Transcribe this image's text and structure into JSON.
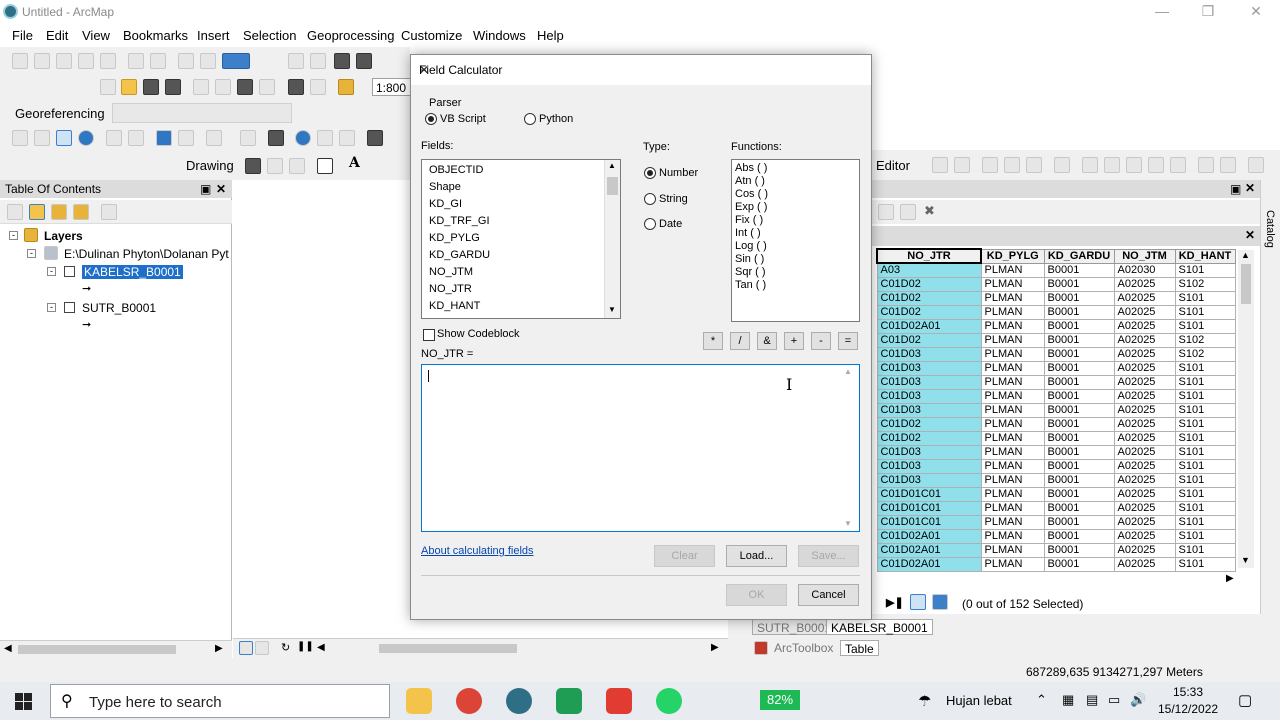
{
  "window": {
    "title": "Untitled - ArcMap"
  },
  "menu": [
    "File",
    "Edit",
    "View",
    "Bookmarks",
    "Insert",
    "Selection",
    "Geoprocessing",
    "Customize",
    "Windows",
    "Help"
  ],
  "toolbar": {
    "scale": "1:800",
    "georeferencing": "Georeferencing",
    "drawing": "Drawing",
    "editor": "Editor"
  },
  "toc": {
    "title": "Table Of Contents",
    "root": "Layers",
    "path": "E:\\Dulinan Phyton\\Dolanan Pyt",
    "layers": [
      "KABELSR_B0001",
      "SUTR_B0001"
    ]
  },
  "table": {
    "headers": [
      "NO_JTR",
      "KD_PYLG",
      "KD_GARDU",
      "NO_JTM",
      "KD_HANT"
    ],
    "rows": [
      [
        "A03",
        "PLMAN",
        "B0001",
        "A02030",
        "S101"
      ],
      [
        "C01D02",
        "PLMAN",
        "B0001",
        "A02025",
        "S102"
      ],
      [
        "C01D02",
        "PLMAN",
        "B0001",
        "A02025",
        "S101"
      ],
      [
        "C01D02",
        "PLMAN",
        "B0001",
        "A02025",
        "S101"
      ],
      [
        "C01D02A01",
        "PLMAN",
        "B0001",
        "A02025",
        "S101"
      ],
      [
        "C01D02",
        "PLMAN",
        "B0001",
        "A02025",
        "S102"
      ],
      [
        "C01D03",
        "PLMAN",
        "B0001",
        "A02025",
        "S102"
      ],
      [
        "C01D03",
        "PLMAN",
        "B0001",
        "A02025",
        "S101"
      ],
      [
        "C01D03",
        "PLMAN",
        "B0001",
        "A02025",
        "S101"
      ],
      [
        "C01D03",
        "PLMAN",
        "B0001",
        "A02025",
        "S101"
      ],
      [
        "C01D03",
        "PLMAN",
        "B0001",
        "A02025",
        "S101"
      ],
      [
        "C01D02",
        "PLMAN",
        "B0001",
        "A02025",
        "S101"
      ],
      [
        "C01D02",
        "PLMAN",
        "B0001",
        "A02025",
        "S101"
      ],
      [
        "C01D03",
        "PLMAN",
        "B0001",
        "A02025",
        "S101"
      ],
      [
        "C01D03",
        "PLMAN",
        "B0001",
        "A02025",
        "S101"
      ],
      [
        "C01D03",
        "PLMAN",
        "B0001",
        "A02025",
        "S101"
      ],
      [
        "C01D01C01",
        "PLMAN",
        "B0001",
        "A02025",
        "S101"
      ],
      [
        "C01D01C01",
        "PLMAN",
        "B0001",
        "A02025",
        "S101"
      ],
      [
        "C01D01C01",
        "PLMAN",
        "B0001",
        "A02025",
        "S101"
      ],
      [
        "C01D02A01",
        "PLMAN",
        "B0001",
        "A02025",
        "S101"
      ],
      [
        "C01D02A01",
        "PLMAN",
        "B0001",
        "A02025",
        "S101"
      ],
      [
        "C01D02A01",
        "PLMAN",
        "B0001",
        "A02025",
        "S101"
      ]
    ],
    "selection": "(0 out of 152 Selected)",
    "tabs": [
      "SUTR_B0001",
      "KABELSR_B0001"
    ],
    "bottom_tabs": [
      "ArcToolbox",
      "Table"
    ]
  },
  "catalog": "Catalog",
  "status": {
    "coords": "687289,635  9134271,297 Meters"
  },
  "dialog": {
    "title": "Field Calculator",
    "parser_label": "Parser",
    "parser_options": [
      "VB Script",
      "Python"
    ],
    "fields_label": "Fields:",
    "fields": [
      "OBJECTID",
      "Shape",
      "KD_GI",
      "KD_TRF_GI",
      "KD_PYLG",
      "KD_GARDU",
      "NO_JTM",
      "NO_JTR",
      "KD_HANT"
    ],
    "type_label": "Type:",
    "types": [
      "Number",
      "String",
      "Date"
    ],
    "functions_label": "Functions:",
    "functions": [
      "Abs ( )",
      "Atn ( )",
      "Cos ( )",
      "Exp ( )",
      "Fix ( )",
      "Int ( )",
      "Log ( )",
      "Sin ( )",
      "Sqr ( )",
      "Tan ( )"
    ],
    "show_codeblock": "Show Codeblock",
    "expression_label": "NO_JTR =",
    "operators": [
      "*",
      "/",
      "&",
      "+",
      "-",
      "="
    ],
    "about_link": "About calculating fields",
    "clear": "Clear",
    "load": "Load...",
    "save": "Save...",
    "ok": "OK",
    "cancel": "Cancel"
  },
  "taskbar": {
    "search_placeholder": "Type here to search",
    "battery": "82%",
    "weather": "Hujan lebat",
    "time": "15:33",
    "date": "15/12/2022"
  }
}
